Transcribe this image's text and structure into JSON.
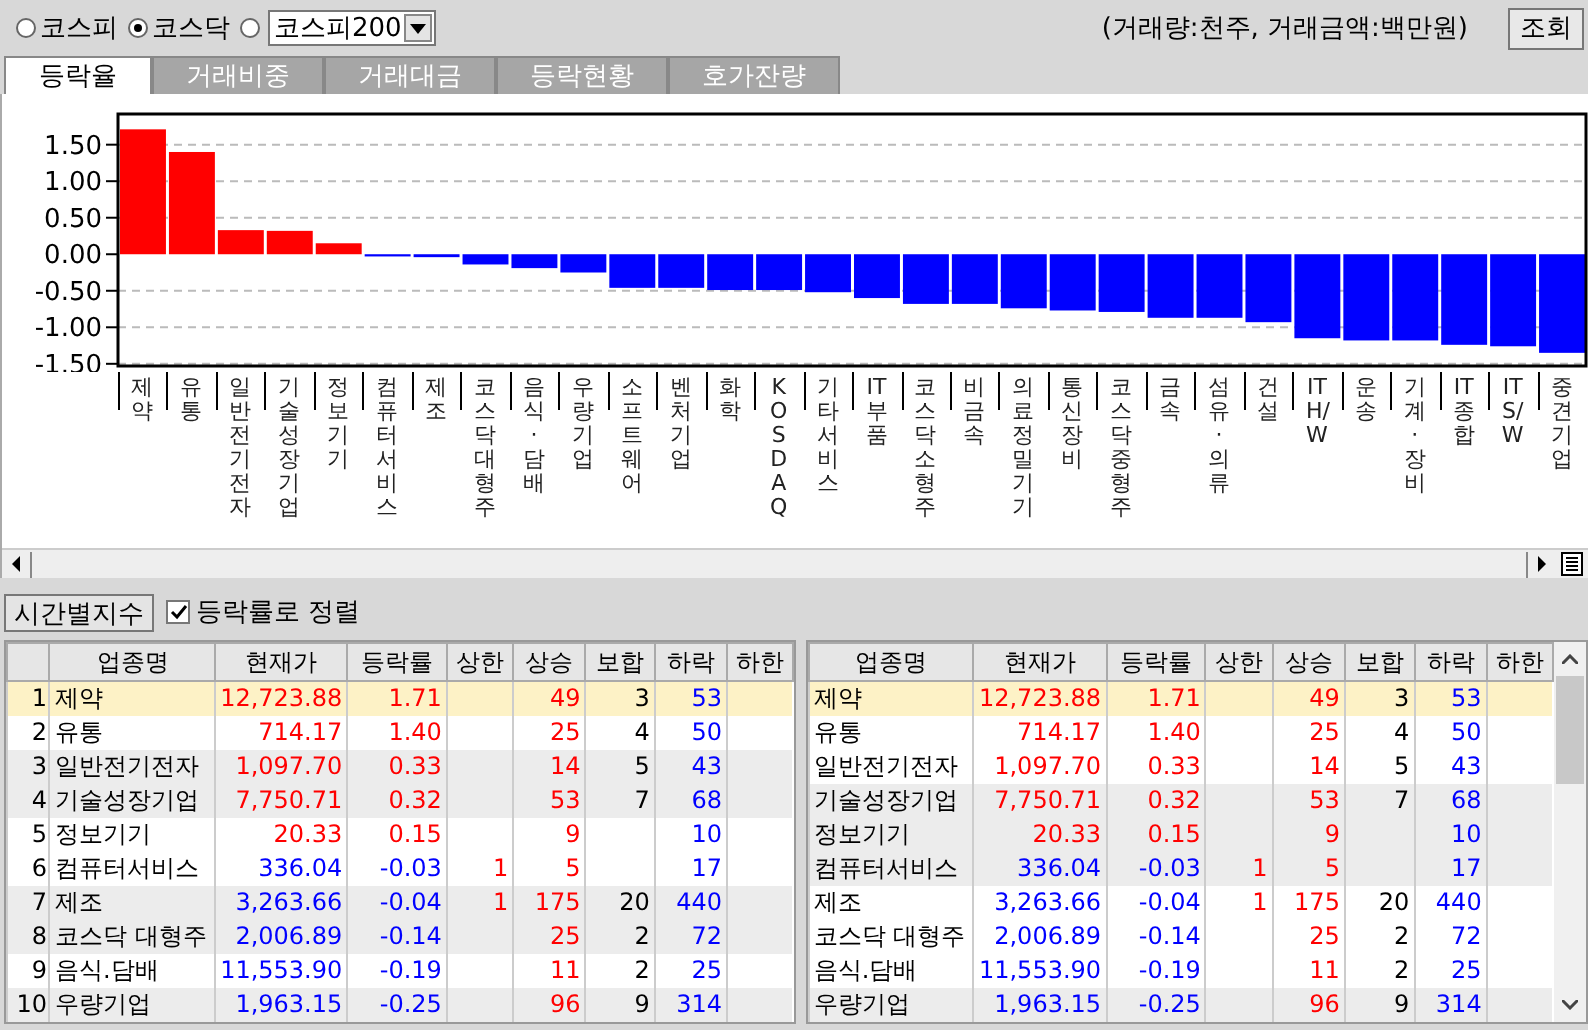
{
  "market_selector": {
    "options": [
      {
        "label": "코스피",
        "selected": false
      },
      {
        "label": "코스닥",
        "selected": true
      },
      {
        "selected": false
      }
    ],
    "dropdown": {
      "value": "코스피200"
    }
  },
  "units_note": "(거래량:천주, 거래금액:백만원)",
  "query_button": "조회",
  "tabs": [
    {
      "label": "등락율",
      "selected": true
    },
    {
      "label": "거래비중",
      "selected": false
    },
    {
      "label": "거래대금",
      "selected": false
    },
    {
      "label": "등락현황",
      "selected": false
    },
    {
      "label": "호가잔량",
      "selected": false
    }
  ],
  "chart": {
    "chart_data": {
      "type": "bar",
      "grid": true,
      "categories": [
        "제약",
        "유통",
        "일반전기전자",
        "기술성장기업",
        "정보기기",
        "컴퓨터서비스",
        "제조",
        "코스닥 대형주",
        "음식·담배",
        "우량기업",
        "소프트웨어",
        "벤처기업",
        "화학",
        "KOSDAQ",
        "기타서비스",
        "IT부품",
        "코스닥 소형주",
        "비금속",
        "의료정밀기기",
        "통신장비",
        "코스닥 중형주",
        "금속",
        "섬유·의류",
        "건설",
        "IT H/W",
        "운송",
        "기계·장비",
        "IT종합",
        "IT S/W",
        "중견기업"
      ],
      "values": [
        1.71,
        1.4,
        0.33,
        0.32,
        0.15,
        -0.03,
        -0.04,
        -0.14,
        -0.19,
        -0.25,
        -0.46,
        -0.46,
        -0.49,
        -0.49,
        -0.52,
        -0.6,
        -0.68,
        -0.68,
        -0.74,
        -0.77,
        -0.79,
        -0.87,
        -0.87,
        -0.93,
        -1.15,
        -1.18,
        -1.18,
        -1.24,
        -1.26,
        -1.35
      ],
      "ylim": [
        -1.53,
        1.92
      ],
      "yticks": [
        {
          "value": 1.5,
          "label": "1.50"
        },
        {
          "value": 1,
          "label": "1.00"
        },
        {
          "value": 0.5,
          "label": "0.50"
        },
        {
          "value": 0,
          "label": "0.00"
        },
        {
          "value": -0.5,
          "label": "-0.50"
        },
        {
          "value": -1,
          "label": "-1.00"
        },
        {
          "value": -1.5,
          "label": "-1.50"
        }
      ]
    }
  },
  "time_index_button": "시간별지수",
  "sort_checkbox": {
    "label": "등락률로 정렬",
    "checked": true
  },
  "tables": [
    {
      "columns": [
        "업종명",
        "현재가",
        "등락률",
        "상한",
        "상승",
        "보합",
        "하락",
        "하한"
      ],
      "rows": [
        {
          "index": "1",
          "name": "제약",
          "price": "12,723.88",
          "rate": "1.71",
          "rise": "49",
          "unchanged": "3",
          "fall": "53",
          "rising": true,
          "selected": true
        },
        {
          "index": "2",
          "name": "유통",
          "price": "714.17",
          "rate": "1.40",
          "rise": "25",
          "unchanged": "4",
          "fall": "50",
          "rising": true,
          "selected": false
        },
        {
          "index": "3",
          "name": "일반전기전자",
          "price": "1,097.70",
          "rate": "0.33",
          "rise": "14",
          "unchanged": "5",
          "fall": "43",
          "rising": true,
          "selected": false
        },
        {
          "index": "4",
          "name": "기술성장기업",
          "price": "7,750.71",
          "rate": "0.32",
          "rise": "53",
          "unchanged": "7",
          "fall": "68",
          "rising": true,
          "selected": false
        },
        {
          "index": "5",
          "name": "정보기기",
          "price": "20.33",
          "rate": "0.15",
          "rise": "9",
          "fall": "10",
          "rising": true,
          "selected": false
        },
        {
          "index": "6",
          "name": "컴퓨터서비스",
          "price": "336.04",
          "rate": "-0.03",
          "upper_limit": "1",
          "rise": "5",
          "fall": "17",
          "rising": false,
          "selected": false
        },
        {
          "index": "7",
          "name": "제조",
          "price": "3,263.66",
          "rate": "-0.04",
          "upper_limit": "1",
          "rise": "175",
          "unchanged": "20",
          "fall": "440",
          "rising": false,
          "selected": false
        },
        {
          "index": "8",
          "name": "코스닥 대형주",
          "price": "2,006.89",
          "rate": "-0.14",
          "rise": "25",
          "unchanged": "2",
          "fall": "72",
          "rising": false,
          "selected": false
        },
        {
          "index": "9",
          "name": "음식.담배",
          "price": "11,553.90",
          "rate": "-0.19",
          "rise": "11",
          "unchanged": "2",
          "fall": "25",
          "rising": false,
          "selected": false
        },
        {
          "index": "10",
          "name": "우량기업",
          "price": "1,963.15",
          "rate": "-0.25",
          "rise": "96",
          "unchanged": "9",
          "fall": "314",
          "rising": false,
          "selected": false
        }
      ]
    },
    {
      "columns": [
        "업종명",
        "현재가",
        "등락률",
        "상한",
        "상승",
        "보합",
        "하락",
        "하한"
      ],
      "rows": [
        {
          "name": "제약",
          "price": "12,723.88",
          "rate": "1.71",
          "rise": "49",
          "unchanged": "3",
          "fall": "53",
          "rising": true,
          "selected": true
        },
        {
          "name": "유통",
          "price": "714.17",
          "rate": "1.40",
          "rise": "25",
          "unchanged": "4",
          "fall": "50",
          "rising": true,
          "selected": false
        },
        {
          "name": "일반전기전자",
          "price": "1,097.70",
          "rate": "0.33",
          "rise": "14",
          "unchanged": "5",
          "fall": "43",
          "rising": true,
          "selected": false
        },
        {
          "name": "기술성장기업",
          "price": "7,750.71",
          "rate": "0.32",
          "rise": "53",
          "unchanged": "7",
          "fall": "68",
          "rising": true,
          "selected": false
        },
        {
          "name": "정보기기",
          "price": "20.33",
          "rate": "0.15",
          "rise": "9",
          "fall": "10",
          "rising": true,
          "selected": false
        },
        {
          "name": "컴퓨터서비스",
          "price": "336.04",
          "rate": "-0.03",
          "upper_limit": "1",
          "rise": "5",
          "fall": "17",
          "rising": false,
          "selected": false
        },
        {
          "name": "제조",
          "price": "3,263.66",
          "rate": "-0.04",
          "upper_limit": "1",
          "rise": "175",
          "unchanged": "20",
          "fall": "440",
          "rising": false,
          "selected": false
        },
        {
          "name": "코스닥 대형주",
          "price": "2,006.89",
          "rate": "-0.14",
          "rise": "25",
          "unchanged": "2",
          "fall": "72",
          "rising": false,
          "selected": false
        },
        {
          "name": "음식.담배",
          "price": "11,553.90",
          "rate": "-0.19",
          "rise": "11",
          "unchanged": "2",
          "fall": "25",
          "rising": false,
          "selected": false
        },
        {
          "name": "우량기업",
          "price": "1,963.15",
          "rate": "-0.25",
          "rise": "96",
          "unchanged": "9",
          "fall": "314",
          "rising": false,
          "selected": false
        }
      ]
    }
  ]
}
